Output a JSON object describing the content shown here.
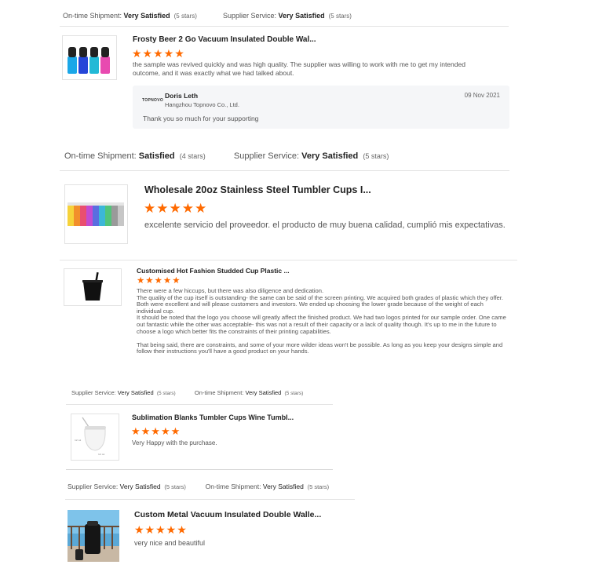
{
  "reviews": [
    {
      "rating_line": {
        "a_label": "On-time Shipment:",
        "a_value": "Very Satisfied",
        "a_stars": "(5 stars)",
        "b_label": "Supplier Service:",
        "b_value": "Very Satisfied",
        "b_stars": "(5 stars)"
      },
      "title": "Frosty Beer 2 Go Vacuum Insulated Double Wal...",
      "stars": "★★★★★",
      "text": "the sample was revived quickly and was high quality. The supplier was willing to work with me to get my intended outcome, and it was exactly what we had talked about.",
      "reply": {
        "logo": "TOPNOVO",
        "name": "Doris Leth",
        "company": "Hangzhou Topnovo Co., Ltd.",
        "date": "09 Nov 2021",
        "text": "Thank you so much for your supporting"
      }
    },
    {
      "rating_line": {
        "a_label": "On-time Shipment:",
        "a_value": "Satisfied",
        "a_stars": "(4 stars)",
        "b_label": "Supplier Service:",
        "b_value": "Very Satisfied",
        "b_stars": "(5 stars)"
      },
      "title": "Wholesale 20oz Stainless Steel Tumbler Cups I...",
      "stars": "★★★★★",
      "text": "excelente servicio del proveedor.  el producto de muy buena calidad, cumplió mis expectativas."
    },
    {
      "title": "Customised Hot Fashion Studded Cup Plastic ...",
      "stars": "★★★★★",
      "text": "There were a few hiccups, but there was also diligence and dedication.\nThe quality of the cup itself is outstanding- the same can be said of the screen printing. We acquired both grades of plastic which they offer. Both were excellent and will please customers and investors. We ended up choosing the lower grade because of the weight of each individual cup.\nIt should be noted that the logo you choose will greatly affect the finished product. We had two logos printed for our sample order. One came out fantastic while the other was acceptable- this was not a result of their capacity or a lack of quality though. It's up to me in the future to choose a logo which better fits the constraints of their printing capabilities.\n\nThat being said, there are constraints, and some of your more wilder ideas won't be possible. As long as you keep your designs simple and follow their instructions you'll have a good product on your hands."
    },
    {
      "rating_line": {
        "a_label": "Supplier Service:",
        "a_value": "Very Satisfied",
        "a_stars": "(5 stars)",
        "b_label": "On-time Shipment:",
        "b_value": "Very Satisfied",
        "b_stars": "(5 stars)"
      },
      "title": "Sublimation Blanks Tumbler Cups Wine Tumbl...",
      "stars": "★★★★★",
      "text": "Very Happy with the purchase."
    },
    {
      "rating_line": {
        "a_label": "Supplier Service:",
        "a_value": "Very Satisfied",
        "a_stars": "(5 stars)",
        "b_label": "On-time Shipment:",
        "b_value": "Very Satisfied",
        "b_stars": "(5 stars)"
      },
      "title": "Custom Metal Vacuum Insulated Double Walle...",
      "stars": "★★★★★",
      "text": "very nice and beautiful"
    }
  ],
  "colors": {
    "star": "#ff6a00",
    "divider": "#e4e4e4",
    "reply_bg": "#f5f6f8"
  },
  "icons": [
    "product-thumbnail-image",
    "topnovo-logo"
  ]
}
